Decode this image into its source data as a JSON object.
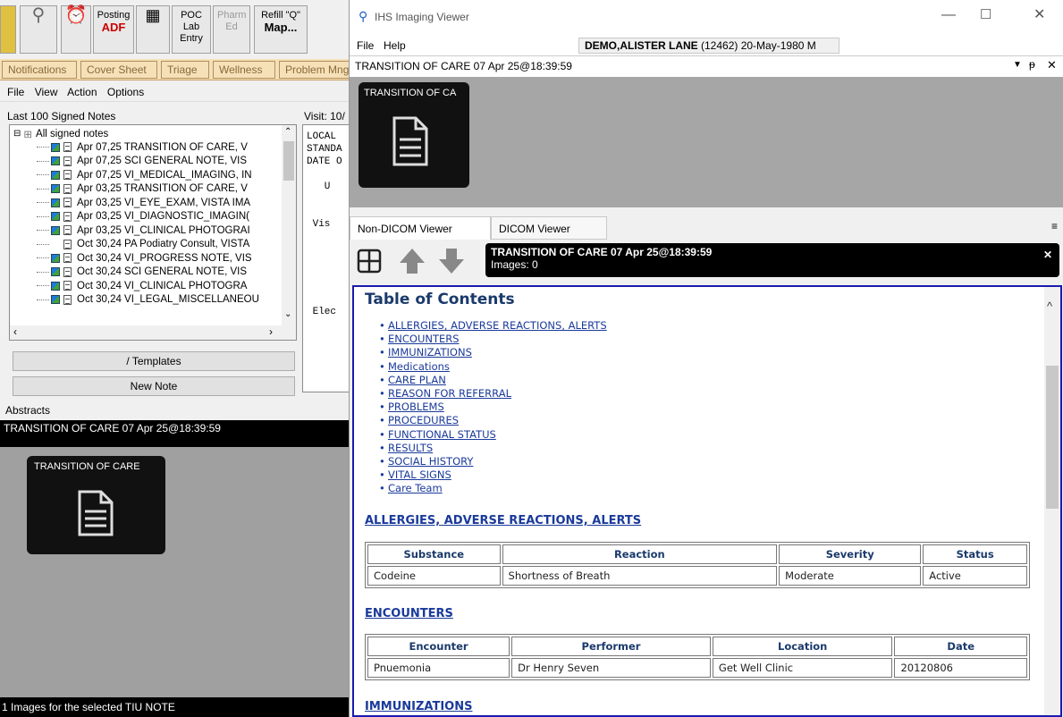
{
  "left_app": {
    "toolbar": {
      "posting_label": "Posting",
      "adf_label": "ADF",
      "poc_lab_label": "POC Lab Entry",
      "pharm_ed_label": "Pharm Ed",
      "refill_label": "Refill \"Q\"",
      "map_label": "Map..."
    },
    "tabs": [
      "Notifications",
      "Cover Sheet",
      "Triage",
      "Wellness",
      "Problem Mng"
    ],
    "menu": [
      "File",
      "View",
      "Action",
      "Options"
    ],
    "notes_list_label": "Last 100 Signed Notes",
    "visit_label": "Visit: 10/",
    "tree_root": "All signed notes",
    "notes": [
      "Apr 07,25  TRANSITION OF CARE, V",
      "Apr 07,25  SCI GENERAL NOTE, VIS",
      "Apr 07,25  VI_MEDICAL_IMAGING, IN",
      "Apr 03,25  TRANSITION OF CARE, V",
      "Apr 03,25  VI_EYE_EXAM, VISTA IMA",
      "Apr 03,25  VI_DIAGNOSTIC_IMAGIN(",
      "Apr 03,25  VI_CLINICAL PHOTOGRAI",
      "Oct 30,24  PA Podiatry Consult, VISTA",
      "Oct 30,24  VI_PROGRESS NOTE, VIS",
      "Oct 30,24  SCI GENERAL NOTE, VIS",
      "Oct 30,24  VI_CLINICAL PHOTOGRA",
      "Oct 30,24  VI_LEGAL_MISCELLANEOU"
    ],
    "visit_text": "LOCAL\nSTANDA\nDATE O\n\n   U\n\n\n Vis\n\n\n\n\n\n\n Elec",
    "templates_button": "/ Templates",
    "new_note_button": "New Note",
    "abstracts_label": "Abstracts",
    "abstracts_header": "TRANSITION OF CARE  07 Apr 25@18:39:59",
    "abstract_thumb_label": "TRANSITION OF CARE",
    "status": "1 Images for the selected TIU NOTE"
  },
  "viewer": {
    "title": "IHS Imaging Viewer",
    "menu": [
      "File",
      "Help"
    ],
    "patient_bold": "DEMO,ALISTER LANE",
    "patient_rest": "(12462) 20-May-1980 M",
    "doc_title": "TRANSITION OF CARE  07 Apr 25@18:39:59",
    "thumb_label": "TRANSITION OF CA",
    "tabs": [
      "Non-DICOM Viewer",
      "DICOM Viewer"
    ],
    "bar_title": "TRANSITION OF CARE  07 Apr 25@18:39:59",
    "bar_images": "Images: 0",
    "toc_title": "Table of Contents",
    "toc": [
      "ALLERGIES, ADVERSE REACTIONS, ALERTS",
      "ENCOUNTERS",
      "IMMUNIZATIONS",
      "Medications",
      "CARE PLAN",
      "REASON FOR REFERRAL",
      "PROBLEMS",
      "PROCEDURES",
      "FUNCTIONAL STATUS",
      "RESULTS",
      "SOCIAL HISTORY",
      "VITAL SIGNS",
      "Care Team"
    ],
    "allergies": {
      "title": "ALLERGIES, ADVERSE REACTIONS, ALERTS",
      "headers": [
        "Substance",
        "Reaction",
        "Severity",
        "Status"
      ],
      "rows": [
        [
          "Codeine",
          "Shortness of Breath",
          "Moderate",
          "Active"
        ]
      ]
    },
    "encounters": {
      "title": "ENCOUNTERS",
      "headers": [
        "Encounter",
        "Performer",
        "Location",
        "Date"
      ],
      "rows": [
        [
          "Pnuemonia",
          "Dr Henry Seven",
          "Get Well Clinic",
          "20120806"
        ]
      ]
    },
    "immunizations_title": "IMMUNIZATIONS"
  }
}
